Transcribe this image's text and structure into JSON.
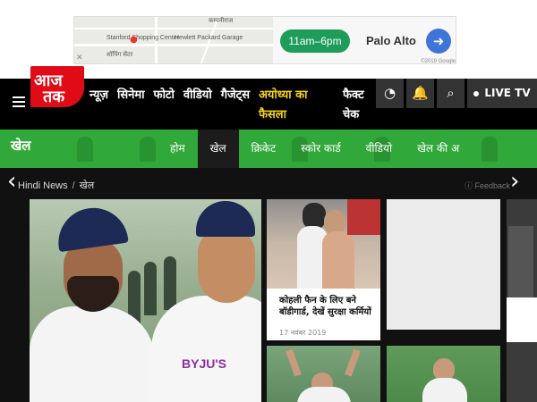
{
  "ad": {
    "hours": "11am–6pm",
    "place": "Palo Alto",
    "close_symbol": "✕",
    "direction_symbol": "➜",
    "map_labels": [
      "कम्पनीराज",
      "Stanford Shopping Center",
      "Hewlett Packard Garage",
      "शॉपिंग सेंटर",
      "Google"
    ],
    "copyright": "©2019 Google"
  },
  "nav": {
    "logo_line1": "आज",
    "logo_line2": "तक",
    "items": [
      "न्यूज़",
      "सिनेमा",
      "फोटो",
      "वीडियो",
      "गैजेट्स"
    ],
    "highlight": "अयोध्या का फैसला",
    "fact_check": "फैक्ट चेक",
    "live_label": "LIVE TV"
  },
  "section": {
    "title": "खेल",
    "tabs": [
      "होम",
      "खेल",
      "क्रिकेट",
      "स्कोर कार्ड",
      "वीडियो",
      "खेल की अ"
    ],
    "active_tab": "खेल"
  },
  "breadcrumb": {
    "home": "Hindi News",
    "current": "खेल",
    "separator": "/"
  },
  "feedback": "Feedback",
  "hero": {
    "sponsor_text": "BYJU'S"
  },
  "cards": [
    {
      "caption": "कोहली फैन के लिए बने बॉडीगार्ड, देखें सुरक्षा कर्मियों",
      "date": "17 नवंबर 2019"
    }
  ],
  "arrows": {
    "left": "‹",
    "right": "›"
  },
  "colors": {
    "brand_red": "#e10a17",
    "nav_black": "#000000",
    "section_green": "#31a83a",
    "highlight_yellow": "#f5d21c"
  }
}
